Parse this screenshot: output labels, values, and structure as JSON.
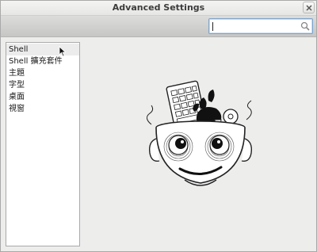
{
  "window": {
    "title": "Advanced Settings"
  },
  "search": {
    "value": "",
    "placeholder": ""
  },
  "sidebar": {
    "items": [
      {
        "label": "Shell"
      },
      {
        "label": "Shell 擴充套件"
      },
      {
        "label": "主題"
      },
      {
        "label": "字型"
      },
      {
        "label": "桌面"
      },
      {
        "label": "視窗"
      }
    ]
  },
  "icons": {
    "close": "close-icon",
    "search": "search-icon",
    "mascot": "head-with-tools-illustration"
  }
}
